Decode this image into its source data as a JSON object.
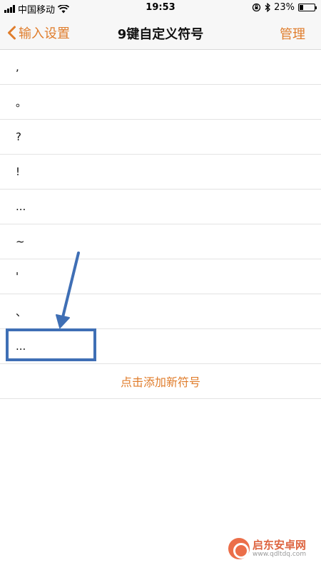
{
  "status_bar": {
    "carrier": "中国移动",
    "time": "19:53",
    "battery_percent": "23%",
    "battery_level": 0.23
  },
  "nav": {
    "back_label": "输入设置",
    "title": "9键自定义符号",
    "manage_label": "管理"
  },
  "symbols": [
    ",",
    "。",
    "?",
    "!",
    "...",
    "~",
    "'",
    "、",
    "..."
  ],
  "add_label": "点击添加新符号",
  "watermark": {
    "name": "启东安卓网",
    "url": "www.qdltdq.com"
  },
  "colors": {
    "accent": "#e07d2c",
    "annotation": "#3f6fb5"
  }
}
